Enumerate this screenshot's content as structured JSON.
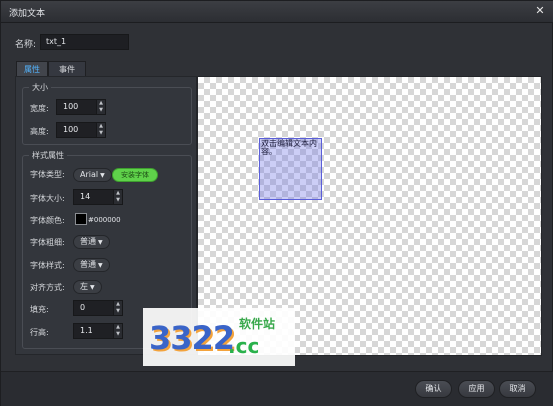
{
  "window": {
    "title": "添加文本",
    "close_glyph": "✕"
  },
  "name_field": {
    "label": "名称:",
    "value": "txt_1"
  },
  "tabs": [
    {
      "label": "属性",
      "active": true
    },
    {
      "label": "事件",
      "active": false
    }
  ],
  "size_group": {
    "title": "大小",
    "width": {
      "label": "宽度:",
      "value": "100"
    },
    "height": {
      "label": "高度:",
      "value": "100"
    }
  },
  "style_group": {
    "title": "样式属性",
    "font_type": {
      "label": "字体类型:",
      "value": "Arial",
      "install_button": "安装字体"
    },
    "font_size": {
      "label": "字体大小:",
      "value": "14"
    },
    "font_color": {
      "label": "字体颜色:",
      "value": "#000000",
      "swatch_color": "#000000"
    },
    "font_weight": {
      "label": "字体粗细:",
      "value": "普通"
    },
    "font_style": {
      "label": "字体样式:",
      "value": "普通"
    },
    "align": {
      "label": "对齐方式:",
      "value": "左"
    },
    "padding": {
      "label": "填充:",
      "value": "0"
    },
    "line_height": {
      "label": "行高:",
      "value": "1.1"
    }
  },
  "canvas": {
    "text_box_content": "双击编辑文本内容。"
  },
  "watermark": {
    "number": "3322",
    "domain": ".cc",
    "site_name": "软件站"
  },
  "footer": {
    "confirm": "确认",
    "apply": "应用",
    "cancel": "取消"
  },
  "icons": {
    "caret": "caret-down-icon",
    "spin_up": "spin-up-icon",
    "spin_down": "spin-down-icon",
    "close": "close-icon"
  }
}
